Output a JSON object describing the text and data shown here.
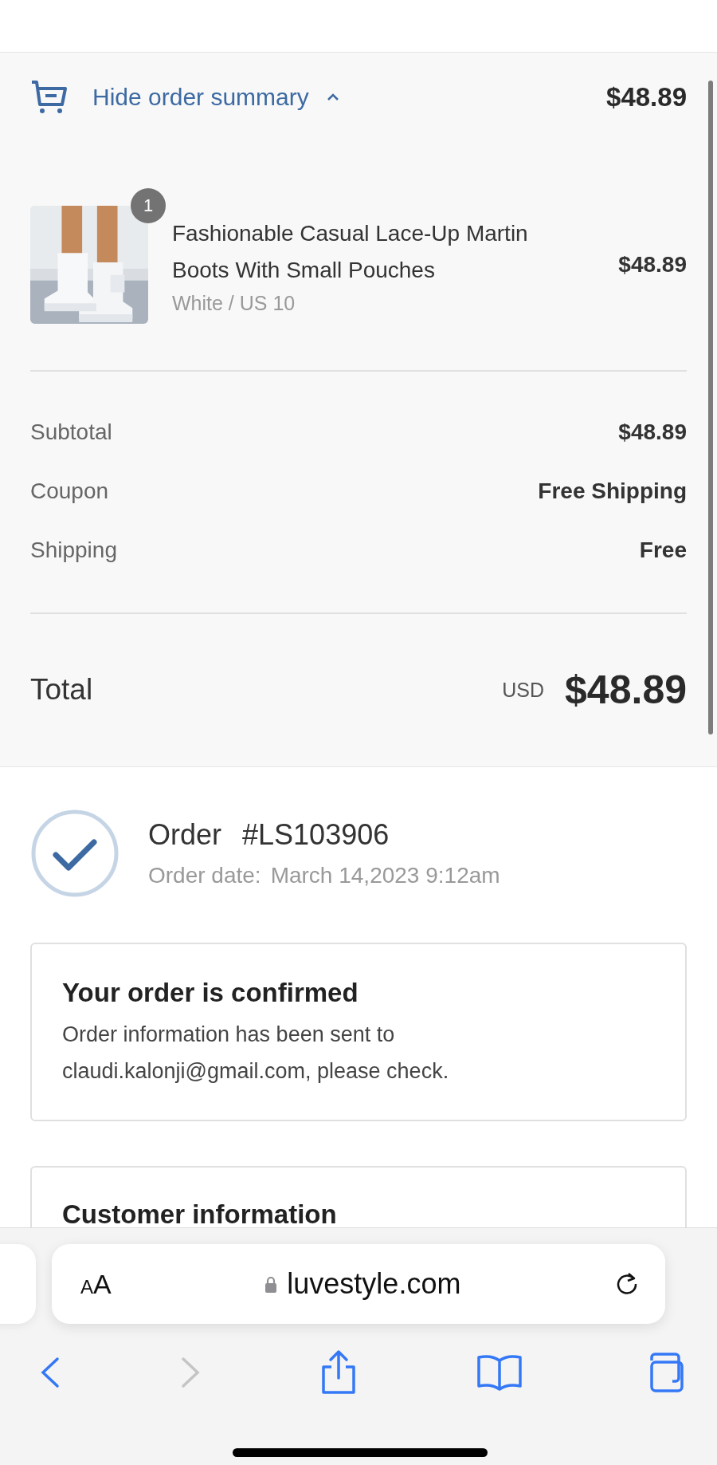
{
  "summary_toggle": {
    "label": "Hide order summary",
    "expanded": true,
    "total": "$48.89"
  },
  "items": [
    {
      "quantity": "1",
      "title": "Fashionable Casual Lace-Up Martin Boots With Small Pouches",
      "variant": "White / US 10",
      "price": "$48.89"
    }
  ],
  "lines": [
    {
      "label": "Subtotal",
      "value": "$48.89"
    },
    {
      "label": "Coupon",
      "value": "Free Shipping"
    },
    {
      "label": "Shipping",
      "value": "Free"
    }
  ],
  "total": {
    "label": "Total",
    "currency": "USD",
    "amount": "$48.89"
  },
  "order": {
    "label": "Order",
    "number": "#LS103906",
    "date_label": "Order date:",
    "date": "March 14,2023 9:12am"
  },
  "confirmation": {
    "title": "Your order is confirmed",
    "message": "Order information has been sent to claudi.kalonji@gmail.com, please check."
  },
  "customer_info": {
    "title": "Customer information"
  },
  "browser": {
    "text_size_label": "AA",
    "url": "luvestyle.com",
    "back_enabled": true,
    "forward_enabled": false
  }
}
